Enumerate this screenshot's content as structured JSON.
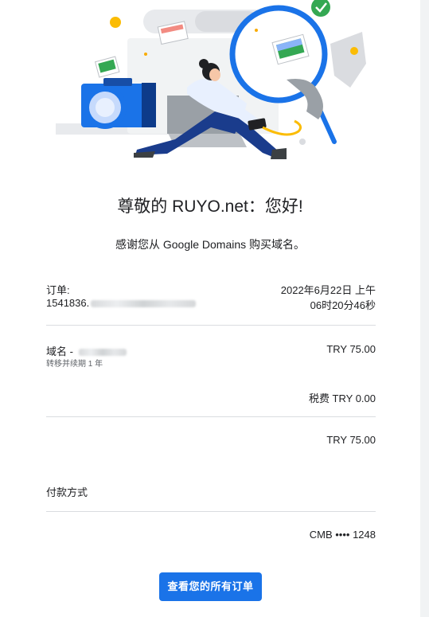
{
  "greeting": "尊敬的 RUYO.net：您好!",
  "thanks": "感谢您从 Google Domains 购买域名。",
  "order": {
    "label": "订单:",
    "number_visible": "1541836.",
    "date_line1": "2022年6月22日 上午",
    "date_line2": "06时20分46秒"
  },
  "item": {
    "label": "域名 -",
    "subtitle": "转移并续期 1 年",
    "price": "TRY 75.00"
  },
  "tax": "税费 TRY 0.00",
  "total": "TRY 75.00",
  "payment": {
    "heading": "付款方式",
    "card": "CMB •••• 1248"
  },
  "cta_label": "查看您的所有订单",
  "colors": {
    "accent": "#1a73e8",
    "divider": "#dadce0"
  }
}
